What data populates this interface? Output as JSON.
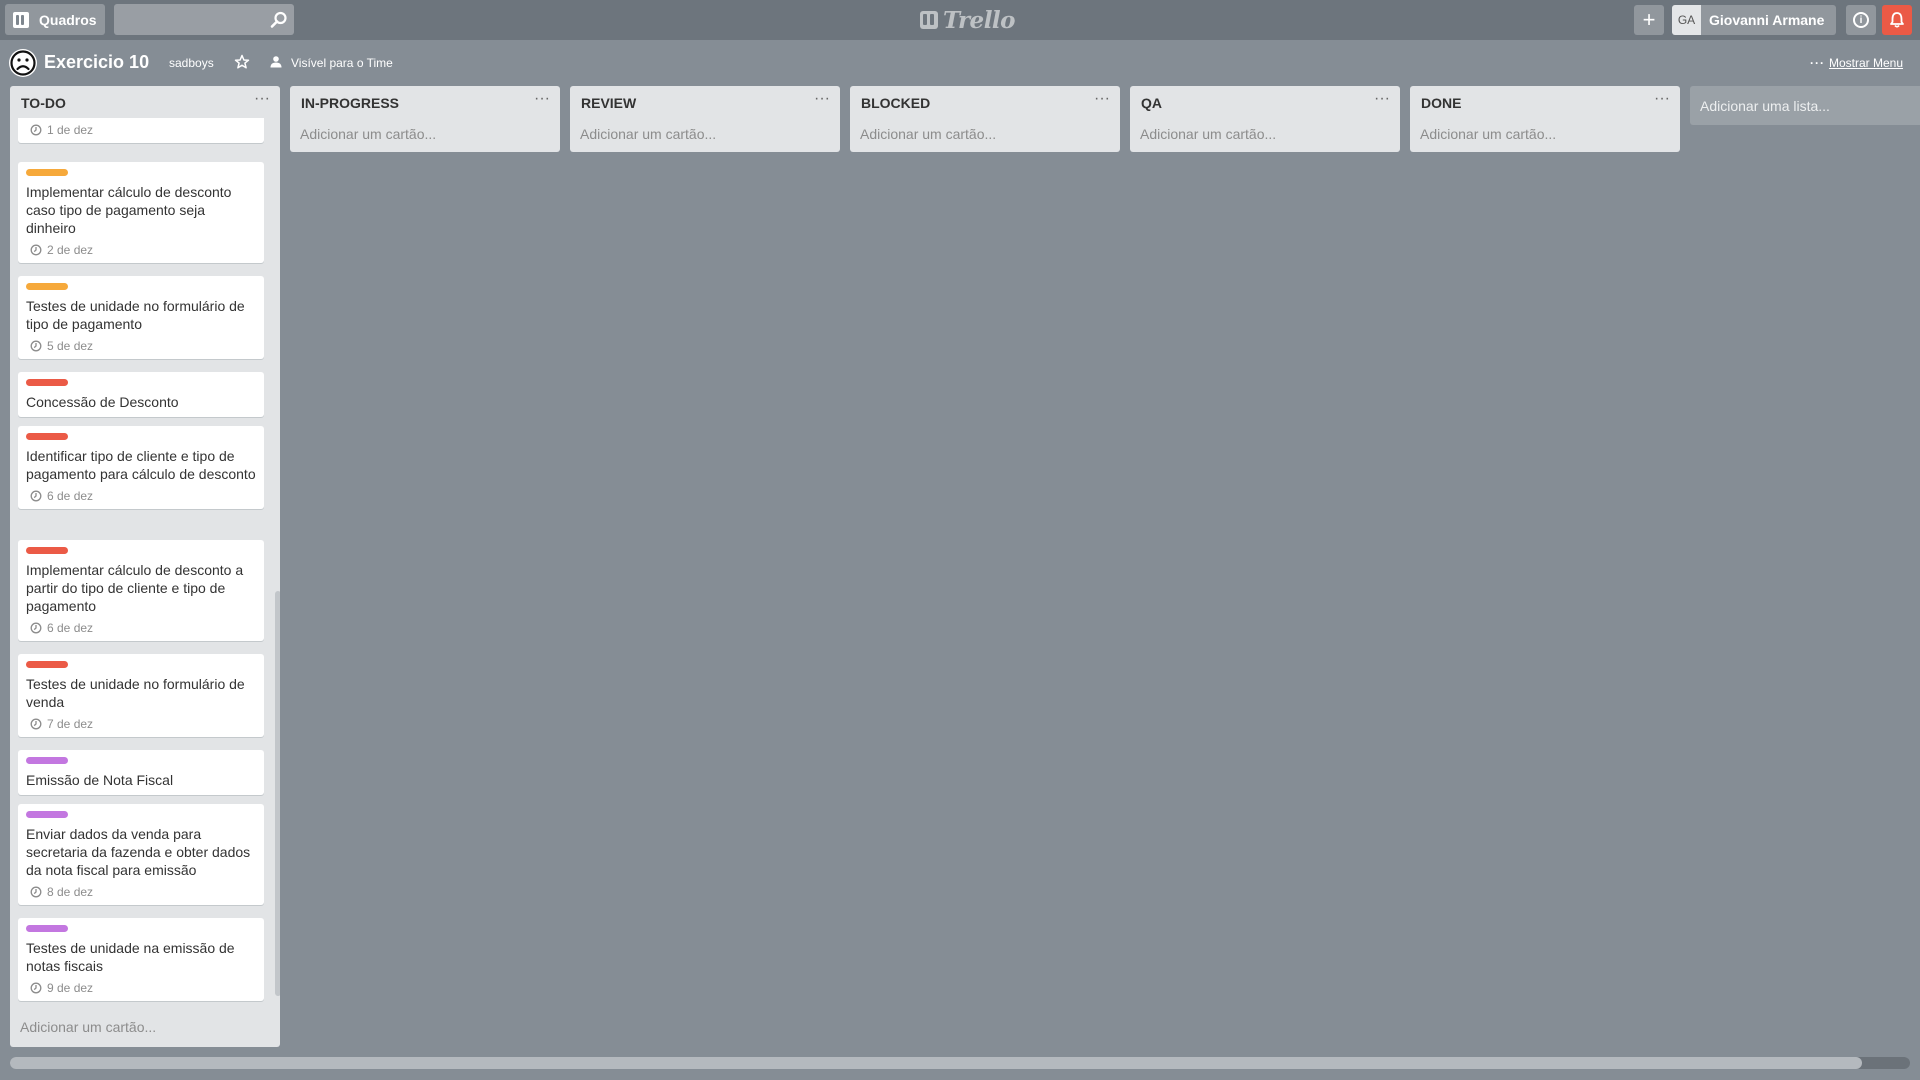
{
  "header": {
    "boards_label": "Quadros",
    "search_placeholder": "",
    "logo_text": "Trello",
    "user_initials": "GA",
    "user_name": "Giovanni Armane"
  },
  "board": {
    "title": "Exercicio 10",
    "team": "sadboys",
    "visibility": "Visível para o Time",
    "show_menu": "Mostrar Menu"
  },
  "colors": {
    "orange": "#f6a93b",
    "red": "#eb5a46",
    "purple": "#c377e0",
    "bell": "#eb5a46"
  },
  "add_card_label": "Adicionar um cartão...",
  "add_list_label": "Adicionar uma lista...",
  "lists": [
    {
      "title": "TO-DO",
      "cards": [
        {
          "title": "",
          "label": null,
          "due": "1 de dez"
        },
        {
          "title": "Implementar cálculo de desconto caso tipo de pagamento seja dinheiro",
          "label": "orange",
          "due": "2 de dez"
        },
        {
          "title": "Testes de unidade no formulário de tipo de pagamento",
          "label": "orange",
          "due": "5 de dez"
        },
        {
          "title": "Concessão de Desconto",
          "label": "red",
          "due": ""
        },
        {
          "title": "Identificar tipo de cliente e tipo de pagamento para cálculo de desconto",
          "label": "red",
          "due": "6 de dez"
        },
        {
          "title": "Implementar cálculo de desconto a partir do tipo de cliente e tipo de pagamento",
          "label": "red",
          "due": "6 de dez"
        },
        {
          "title": "Testes de unidade no formulário de venda",
          "label": "red",
          "due": "7 de dez"
        },
        {
          "title": "Emissão de Nota Fiscal",
          "label": "purple",
          "due": ""
        },
        {
          "title": "Enviar dados da venda para secretaria da fazenda e obter dados da nota fiscal para emissão",
          "label": "purple",
          "due": "8 de dez"
        },
        {
          "title": "Testes de unidade na emissão de notas fiscais",
          "label": "purple",
          "due": "9 de dez"
        }
      ]
    },
    {
      "title": "IN-PROGRESS",
      "cards": []
    },
    {
      "title": "REVIEW",
      "cards": []
    },
    {
      "title": "BLOCKED",
      "cards": []
    },
    {
      "title": "QA",
      "cards": []
    },
    {
      "title": "DONE",
      "cards": []
    }
  ]
}
